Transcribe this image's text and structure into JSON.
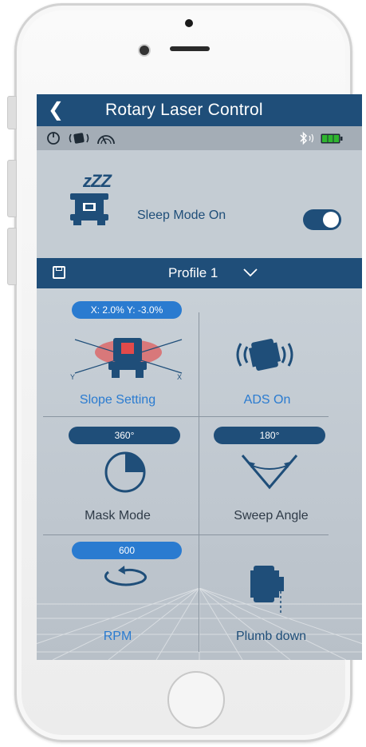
{
  "app": {
    "title": "Rotary Laser Control",
    "back_icon": "chevron-left-icon"
  },
  "status": {
    "icons": [
      "power-icon",
      "laser-device-icon",
      "speedometer-icon",
      "bluetooth-icon",
      "battery-icon"
    ],
    "battery_color": "#2fb52f"
  },
  "sleep": {
    "label": "Sleep Mode On",
    "zzz": "zZZ",
    "enabled": true
  },
  "profile": {
    "label": "Profile 1"
  },
  "tiles": {
    "slope": {
      "badge": "X: 2.0%  Y: -3.0%",
      "label": "Slope Setting",
      "axis_y": "Y",
      "axis_x": "X"
    },
    "ads": {
      "label": "ADS On"
    },
    "mask": {
      "badge": "360°",
      "label": "Mask Mode"
    },
    "sweep": {
      "badge": "180°",
      "label": "Sweep Angle"
    },
    "rpm": {
      "badge": "600",
      "label": "RPM"
    },
    "plumb": {
      "label": "Plumb down"
    }
  },
  "colors": {
    "navy": "#1f4e79",
    "accent_blue": "#2a7bd0",
    "highlight_red": "#e24a4a"
  }
}
